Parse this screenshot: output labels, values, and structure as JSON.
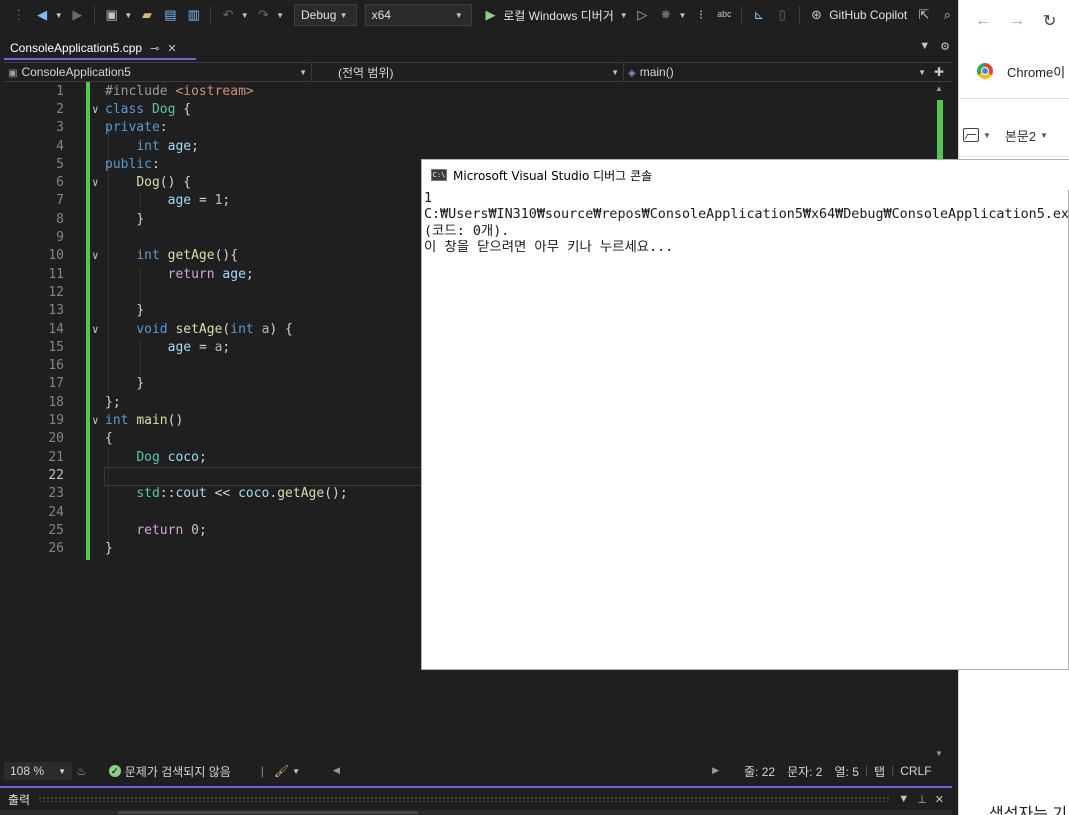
{
  "toolbar": {
    "config": "Debug",
    "platform": "x64",
    "run_label": "로컬 Windows 디버거",
    "copilot_label": "GitHub Copilot"
  },
  "tab": {
    "file_name": "ConsoleApplication5.cpp"
  },
  "navbar": {
    "project": "ConsoleApplication5",
    "scope": "(전역 범위)",
    "member": "main()"
  },
  "editor": {
    "current_line": 22,
    "line_numbers": [
      "1",
      "2",
      "3",
      "4",
      "5",
      "6",
      "7",
      "8",
      "9",
      "10",
      "11",
      "12",
      "13",
      "14",
      "15",
      "16",
      "17",
      "18",
      "19",
      "20",
      "21",
      "22",
      "23",
      "24",
      "25",
      "26"
    ],
    "lines": [
      "#include <iostream>",
      "class Dog {",
      "private:",
      "    int age;",
      "public:",
      "    Dog() {",
      "        age = 1;",
      "    }",
      "",
      "    int getAge(){",
      "        return age;",
      "",
      "    }",
      "    void setAge(int a) {",
      "        age = a;",
      "",
      "    }",
      "};",
      "int main()",
      "{",
      "    Dog coco;",
      "",
      "    std::cout << coco.getAge();",
      "",
      "    return 0;",
      "}"
    ]
  },
  "status": {
    "zoom": "108 %",
    "issues": "문제가 검색되지 않음",
    "line": "줄: 22",
    "char": "문자: 2",
    "col": "열: 5",
    "indent": "탭",
    "eol": "CRLF"
  },
  "output_panel": {
    "title": "출력"
  },
  "console": {
    "title": "Microsoft Visual Studio 디버그 콘솔",
    "lines": [
      "1",
      "C:₩Users₩IN310₩source₩repos₩ConsoleApplication5₩x64₩Debug₩ConsoleApplication5.exe",
      "(코드: 0개).",
      "이 창을 닫으려면 아무 키나 누르세요..."
    ]
  },
  "chrome": {
    "profile_label": "Chrome이",
    "doc_style": "본문2",
    "doc_footer": "생성자는 기"
  },
  "colors": {
    "accent": "#7160e8",
    "change_bar": "#4ec94e",
    "keyword": "#569cd6",
    "type": "#4ec9b0",
    "function": "#dcdcaa",
    "variable": "#9cdcfe"
  }
}
